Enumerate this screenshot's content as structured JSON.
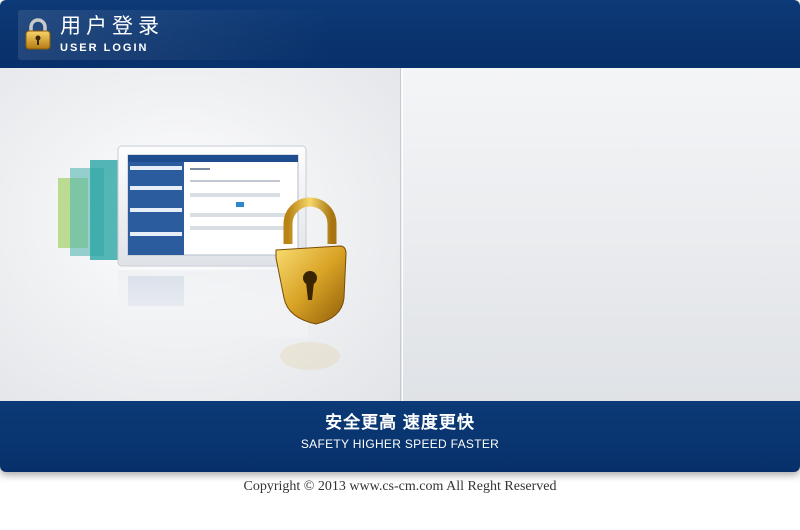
{
  "header": {
    "title_cn": "用户登录",
    "title_en": "USER LOGIN",
    "icon": "padlock-icon"
  },
  "illustration": {
    "description_icon": "security-dashboard-with-padlock-illustration"
  },
  "footer": {
    "slogan_cn": "安全更高 速度更快",
    "slogan_en": "SAFETY HIGHER SPEED FASTER"
  },
  "copyright": "Copyright © 2013 www.cs-cm.com  All Reght Reserved",
  "colors": {
    "header_bg": "#0a336d",
    "footer_bg": "#07306a",
    "content_bg": "#eceef1",
    "accent_gold": "#d4a017"
  }
}
